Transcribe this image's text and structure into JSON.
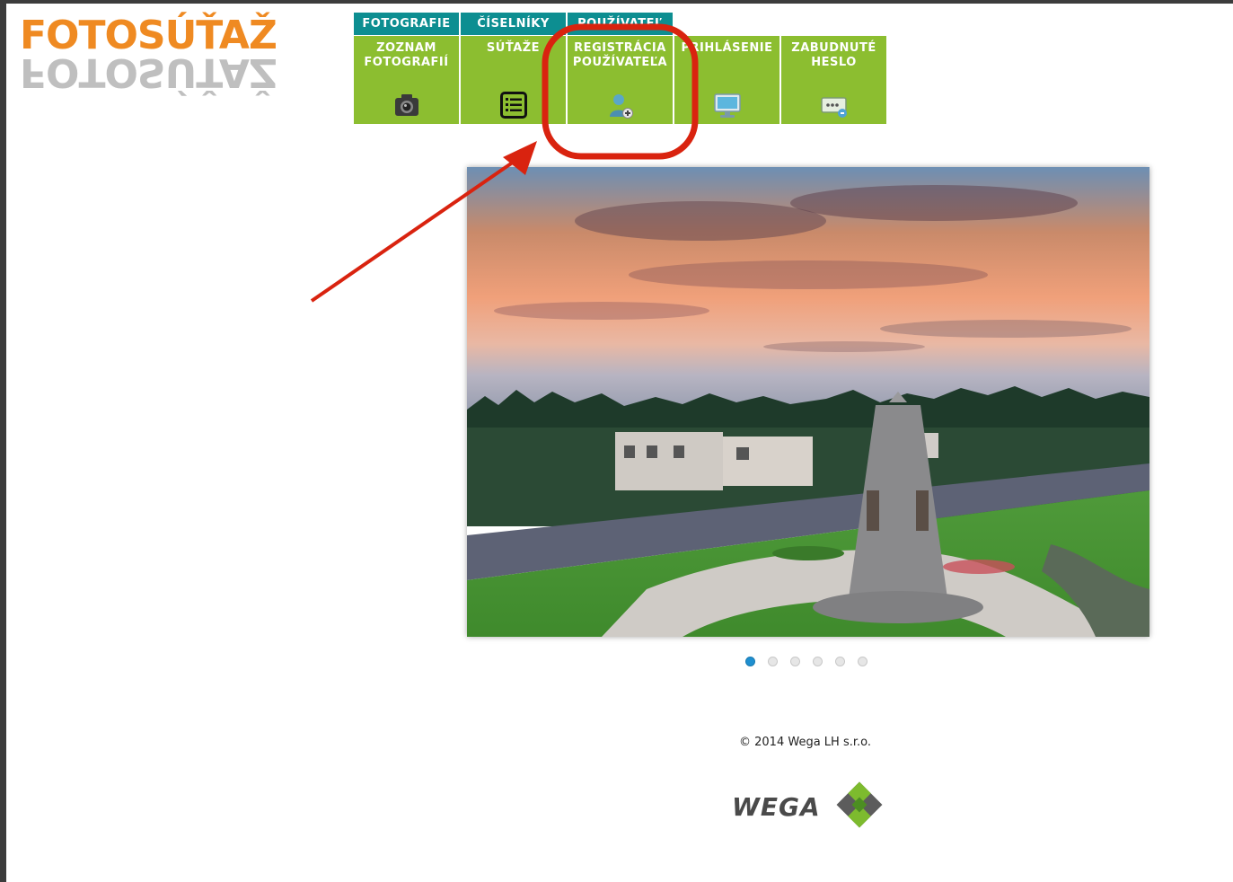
{
  "logo": {
    "text": "FOTOSÚŤAŽ"
  },
  "menu": {
    "top_tabs": [
      {
        "label": "FOTOGRAFIE"
      },
      {
        "label": "ČÍSELNÍKY"
      },
      {
        "label": "POUŽÍVATEĽ"
      }
    ],
    "items": [
      {
        "label_line1": "ZOZNAM",
        "label_line2": "FOTOGRAFIÍ",
        "icon": "camera-icon"
      },
      {
        "label_line1": "SÚŤAŽE",
        "label_line2": "",
        "icon": "list-icon"
      },
      {
        "label_line1": "REGISTRÁCIA",
        "label_line2": "POUŽÍVATEĽA",
        "icon": "add-user-icon"
      },
      {
        "label_line1": "PRIHLÁSENIE",
        "label_line2": "",
        "icon": "monitor-icon"
      },
      {
        "label_line1": "ZABUDNUTÉ",
        "label_line2": "HESLO",
        "icon": "password-key-icon"
      }
    ]
  },
  "slideshow": {
    "total_slides": 6,
    "active_index": 0
  },
  "footer": {
    "copyright": "© 2014 Wega LH s.r.o.",
    "company_logo_text": "WEGA"
  },
  "annotation": {
    "color": "#d9230f"
  },
  "colors": {
    "tab_teal": "#0d8e91",
    "menu_green": "#8cbe30",
    "logo_orange": "#ef8a22"
  }
}
